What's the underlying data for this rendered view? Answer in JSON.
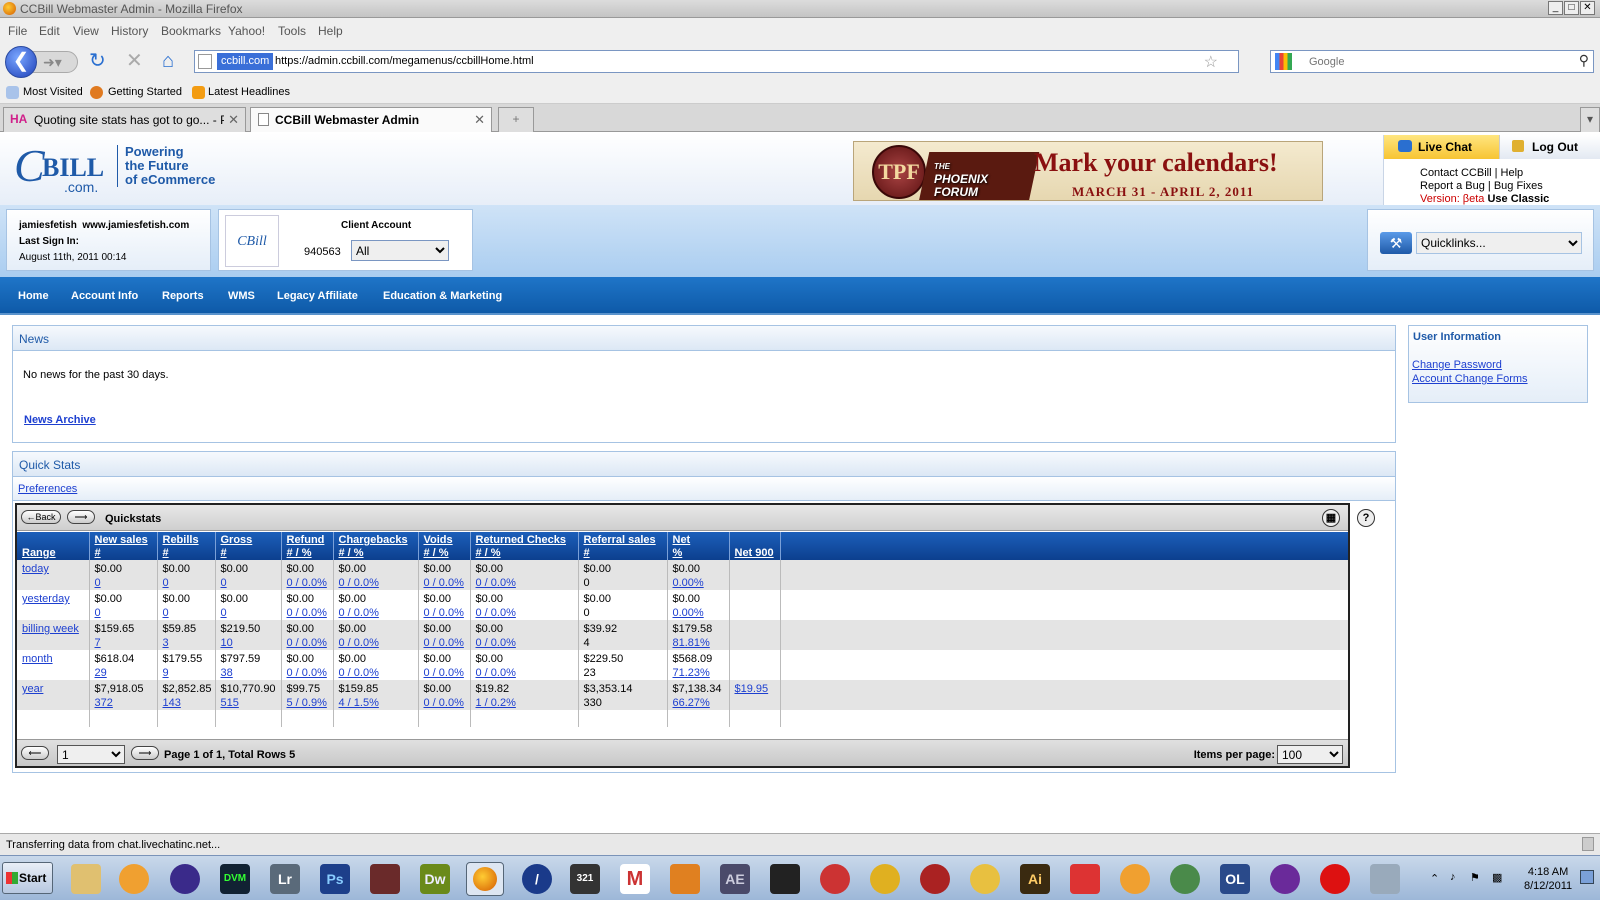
{
  "window": {
    "title": "CCBill Webmaster Admin - Mozilla Firefox"
  },
  "menu": [
    "File",
    "Edit",
    "View",
    "History",
    "Bookmarks",
    "Yahoo!",
    "Tools",
    "Help"
  ],
  "urlbar": {
    "site_label": "ccbill.com",
    "url": "https://admin.ccbill.com/megamenus/ccbillHome.html"
  },
  "search": {
    "placeholder": "Google"
  },
  "bookmarks": [
    "Most Visited",
    "Getting Started",
    "Latest Headlines"
  ],
  "tabs": [
    {
      "label": "Quoting site stats has got to go... - Pa..."
    },
    {
      "label": "CCBill Webmaster Admin"
    }
  ],
  "header": {
    "logo": {
      "c": "C",
      "bill": "BILL",
      "com": ".com."
    },
    "tagline": [
      "Powering",
      "the Future",
      "of eCommerce"
    ],
    "banner": {
      "seal": "TPF",
      "forum_the": "THE",
      "forum_name1": "PHOENIX",
      "forum_name2": "FORUM",
      "headline": "Mark your calendars!",
      "dates": "MARCH 31 - APRIL 2, 2011"
    },
    "live_chat": "Live Chat",
    "log_out": "Log Out",
    "contact": "Contact CCBill",
    "help": "Help",
    "report_bug": "Report a Bug",
    "bug_fixes": "Bug Fixes",
    "version": "Version: βeta",
    "use_classic": "Use Classic"
  },
  "user": {
    "name": "jamiesfetish",
    "site": "www.jamiesfetish.com",
    "last_signin_label": "Last Sign In:",
    "last_signin": "August 11th, 2011 00:14"
  },
  "client": {
    "mini_logo": "CBill",
    "title": "Client Account",
    "number": "940563",
    "selected": "All"
  },
  "quicklinks": {
    "selected": "Quicklinks..."
  },
  "nav": [
    "Home",
    "Account Info",
    "Reports",
    "WMS",
    "Legacy Affiliate",
    "Education & Marketing"
  ],
  "news": {
    "title": "News",
    "message": "No news for the past 30 days.",
    "archive": "News Archive"
  },
  "user_info": {
    "title": "User Information",
    "links": [
      "Change Password",
      "Account Change Forms"
    ]
  },
  "quick_stats": {
    "title": "Quick Stats",
    "preferences": "Preferences",
    "table_title": "Quickstats",
    "back": "Back",
    "columns": [
      {
        "top": "",
        "bottom": "Range"
      },
      {
        "top": "New sales",
        "bottom": "#"
      },
      {
        "top": "Rebills",
        "bottom": "#"
      },
      {
        "top": "Gross",
        "bottom": "#"
      },
      {
        "top": "Refund",
        "bottom": "# / %"
      },
      {
        "top": "Chargebacks",
        "bottom": "# / %"
      },
      {
        "top": "Voids",
        "bottom": "# / %"
      },
      {
        "top": "Returned Checks",
        "bottom": "# / %"
      },
      {
        "top": "Referral sales",
        "bottom": "#"
      },
      {
        "top": "Net",
        "bottom": "%"
      },
      {
        "top": "",
        "bottom": "Net 900"
      }
    ],
    "rows": [
      {
        "range": "today",
        "cells": [
          [
            "$0.00",
            "0"
          ],
          [
            "$0.00",
            "0"
          ],
          [
            "$0.00",
            "0"
          ],
          [
            "$0.00",
            "0 / 0.0%"
          ],
          [
            "$0.00",
            "0 / 0.0%"
          ],
          [
            "$0.00",
            "0 / 0.0%"
          ],
          [
            "$0.00",
            "0 / 0.0%"
          ],
          [
            "$0.00",
            "0"
          ],
          [
            "$0.00",
            "0.00%"
          ],
          [
            "",
            ""
          ]
        ]
      },
      {
        "range": "yesterday",
        "cells": [
          [
            "$0.00",
            "0"
          ],
          [
            "$0.00",
            "0"
          ],
          [
            "$0.00",
            "0"
          ],
          [
            "$0.00",
            "0 / 0.0%"
          ],
          [
            "$0.00",
            "0 / 0.0%"
          ],
          [
            "$0.00",
            "0 / 0.0%"
          ],
          [
            "$0.00",
            "0 / 0.0%"
          ],
          [
            "$0.00",
            "0"
          ],
          [
            "$0.00",
            "0.00%"
          ],
          [
            "",
            ""
          ]
        ]
      },
      {
        "range": "billing week",
        "cells": [
          [
            "$159.65",
            "7"
          ],
          [
            "$59.85",
            "3"
          ],
          [
            "$219.50",
            "10"
          ],
          [
            "$0.00",
            "0 / 0.0%"
          ],
          [
            "$0.00",
            "0 / 0.0%"
          ],
          [
            "$0.00",
            "0 / 0.0%"
          ],
          [
            "$0.00",
            "0 / 0.0%"
          ],
          [
            "$39.92",
            "4"
          ],
          [
            "$179.58",
            "81.81%"
          ],
          [
            "",
            ""
          ]
        ]
      },
      {
        "range": "month",
        "cells": [
          [
            "$618.04",
            "29"
          ],
          [
            "$179.55",
            "9"
          ],
          [
            "$797.59",
            "38"
          ],
          [
            "$0.00",
            "0 / 0.0%"
          ],
          [
            "$0.00",
            "0 / 0.0%"
          ],
          [
            "$0.00",
            "0 / 0.0%"
          ],
          [
            "$0.00",
            "0 / 0.0%"
          ],
          [
            "$229.50",
            "23"
          ],
          [
            "$568.09",
            "71.23%"
          ],
          [
            "",
            ""
          ]
        ]
      },
      {
        "range": "year",
        "cells": [
          [
            "$7,918.05",
            "372"
          ],
          [
            "$2,852.85",
            "143"
          ],
          [
            "$10,770.90",
            "515"
          ],
          [
            "$99.75",
            "5 / 0.9%"
          ],
          [
            "$159.85",
            "4 / 1.5%"
          ],
          [
            "$0.00",
            "0 / 0.0%"
          ],
          [
            "$19.82",
            "1 / 0.2%"
          ],
          [
            "$3,353.14",
            "330"
          ],
          [
            "$7,138.34",
            "66.27%"
          ],
          [
            "$19.95",
            ""
          ]
        ]
      }
    ],
    "page_select": "1",
    "page_info": "Page 1 of 1, Total Rows 5",
    "items_per_page_label": "Items per page:",
    "items_per_page": "100"
  },
  "status": "Transferring data from chat.livechatinc.net...",
  "taskbar": {
    "start": "Start",
    "apps": [
      "Lr",
      "Ps",
      "Dw",
      "AE",
      "Ai",
      "OL"
    ],
    "time": "4:18 AM",
    "date": "8/12/2011"
  }
}
